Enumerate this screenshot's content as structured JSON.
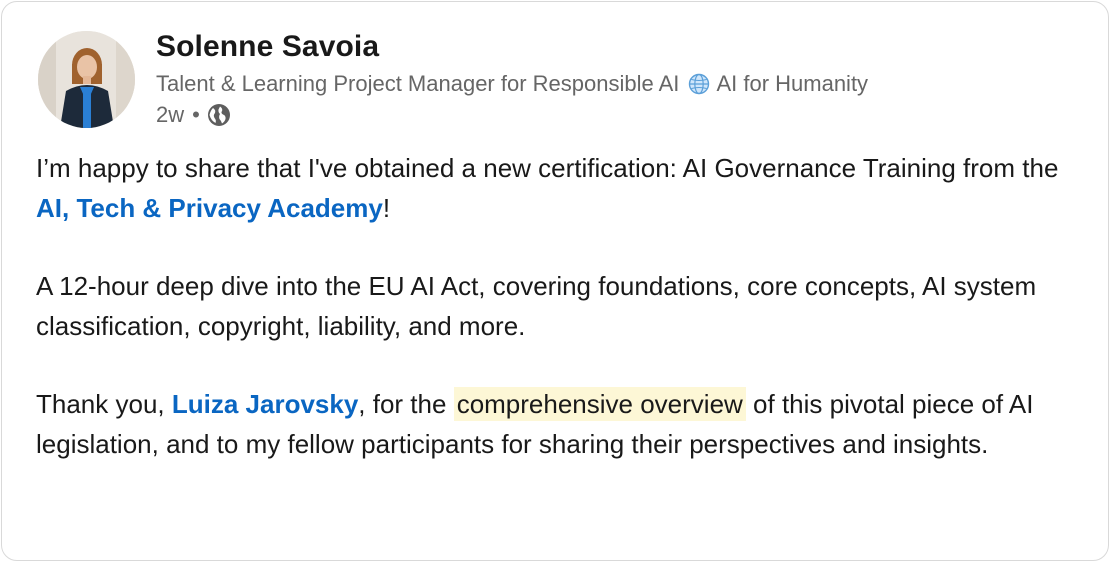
{
  "post": {
    "author": {
      "name": "Solenne Savoia",
      "headline_before_icon": "Talent & Learning Project Manager for Responsible AI",
      "headline_icon": "globe-emoji-icon",
      "headline_after_icon": "AI for Humanity",
      "timestamp": "2w",
      "separator": "•",
      "visibility_icon": "globe-icon"
    },
    "paragraphs": {
      "p1": {
        "text_before_link": "I’m happy to share that I've obtained a new certification: AI Governance Training from the ",
        "link": "AI, Tech & Privacy Academy",
        "text_after_link": "!"
      },
      "p2": {
        "text": "A 12-hour deep dive into the EU AI Act, covering foundations, core concepts, AI system classification, copyright, liability, and more."
      },
      "p3": {
        "text_before_link": "Thank you, ",
        "link": "Luiza Jarovsky",
        "text_middle": ", for the ",
        "highlight": "comprehensive overview",
        "text_after": " of this pivotal piece of AI legislation, and to my fellow participants for sharing their perspectives and insights."
      }
    },
    "colors": {
      "link": "#0a66c2",
      "highlight": "#fdf7d6",
      "text": "#191919",
      "muted": "#666666"
    }
  }
}
